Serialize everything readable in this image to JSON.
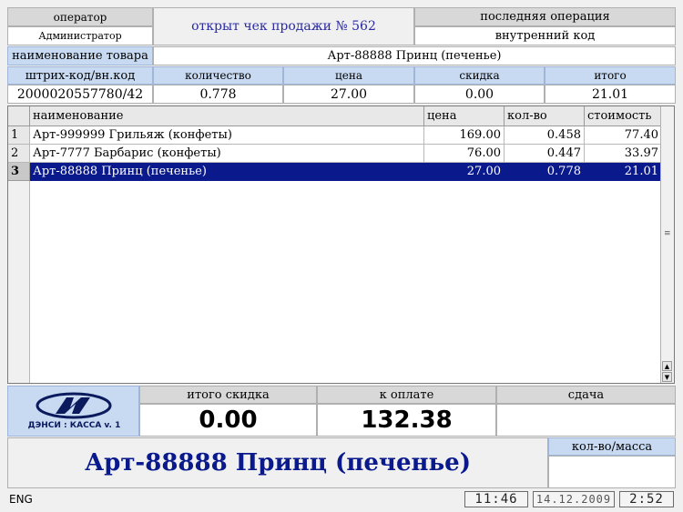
{
  "header": {
    "operator_label": "оператор",
    "operator_value": "Администратор",
    "receipt_status": "открыт чек продажи № 562",
    "last_op_label": "последняя операция",
    "last_op_value": "внутренний код",
    "product_name_label": "наименование товара",
    "product_name_value": "Арт-88888 Принц (печенье)"
  },
  "entry": {
    "barcode_label": "штрих-код/вн.код",
    "barcode_value": "2000020557780/42",
    "qty_label": "количество",
    "qty_value": "0.778",
    "price_label": "цена",
    "price_value": "27.00",
    "discount_label": "скидка",
    "discount_value": "0.00",
    "total_label": "итого",
    "total_value": "21.01"
  },
  "table": {
    "columns": [
      "наименование",
      "цена",
      "кол-во",
      "стоимость"
    ],
    "rows": [
      {
        "num": "1",
        "name": "Арт-999999 Грильяж (конфеты)",
        "price": "169.00",
        "qty": "0.458",
        "cost": "77.40"
      },
      {
        "num": "2",
        "name": "Арт-7777 Барбарис (конфеты)",
        "price": "76.00",
        "qty": "0.447",
        "cost": "33.97"
      },
      {
        "num": "3",
        "name": "Арт-88888 Принц (печенье)",
        "price": "27.00",
        "qty": "0.778",
        "cost": "21.01"
      }
    ],
    "selected_row": 3
  },
  "totals": {
    "discount_label": "итого скидка",
    "discount_value": "0.00",
    "to_pay_label": "к оплате",
    "to_pay_value": "132.38",
    "change_label": "сдача",
    "change_value": ""
  },
  "logo": {
    "caption": "ДЭНСИ : КАССА v. 1"
  },
  "current_item": {
    "name": "Арт-88888 Принц (печенье)",
    "qty_mass_label": "кол-во/масса",
    "qty_mass_value": ""
  },
  "status": {
    "keyboard_layout": "ENG",
    "time": "11:46",
    "date": "14.12.2009",
    "clock2": "2:52"
  },
  "colors": {
    "selection": "#0a1a8c",
    "header_blue": "#c8daf2",
    "status_text": "#2a2aa0",
    "item_text": "#0a1a8c"
  }
}
